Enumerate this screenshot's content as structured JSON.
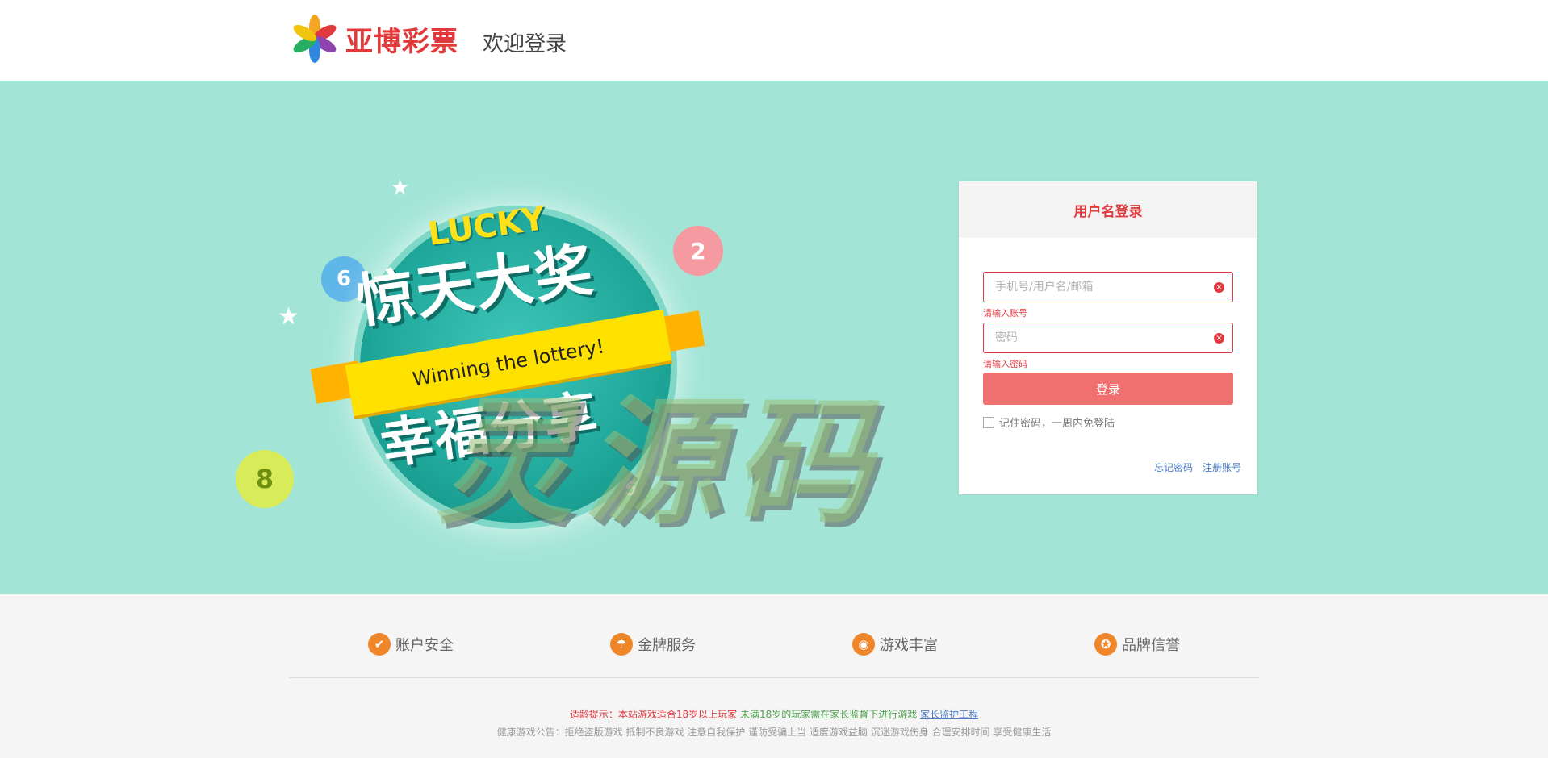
{
  "header": {
    "logo_text": "亚博彩票",
    "welcome": "欢迎登录"
  },
  "banner": {
    "lucky": "LUCKY",
    "title_big": "惊天大奖",
    "ribbon": "Winning the lottery!",
    "title_sub": "幸福分享",
    "ball_numbers": [
      "6",
      "2",
      "8",
      "5"
    ],
    "watermark": "灵源码"
  },
  "login": {
    "title": "用户名登录",
    "username_placeholder": "手机号/用户名/邮箱",
    "username_error": "请输入账号",
    "password_placeholder": "密码",
    "password_error": "请输入密码",
    "submit": "登录",
    "remember": "记住密码，一周内免登陆",
    "forgot": "忘记密码",
    "register": "注册账号"
  },
  "features": [
    {
      "label": "账户安全",
      "icon": "shield-icon"
    },
    {
      "label": "金牌服务",
      "icon": "umbrella-icon"
    },
    {
      "label": "游戏丰富",
      "icon": "gamepad-icon"
    },
    {
      "label": "品牌信誉",
      "icon": "medal-icon"
    }
  ],
  "footer": {
    "notice_label": "适龄提示：本站游戏适合18岁以上玩家",
    "notice_minor": "未满18岁的玩家需在家长监督下进行游戏",
    "notice_link": "家长监护工程",
    "health": "健康游戏公告：拒绝盗版游戏 抵制不良游戏 注意自我保护 谨防受骗上当 适度游戏益脑 沉迷游戏伤身 合理安排时间 享受健康生活"
  },
  "colors": {
    "accent": "#e0393e",
    "banner_bg": "#a2e5d6",
    "feature_icon": "#f0862a",
    "link": "#4a7cc7"
  }
}
